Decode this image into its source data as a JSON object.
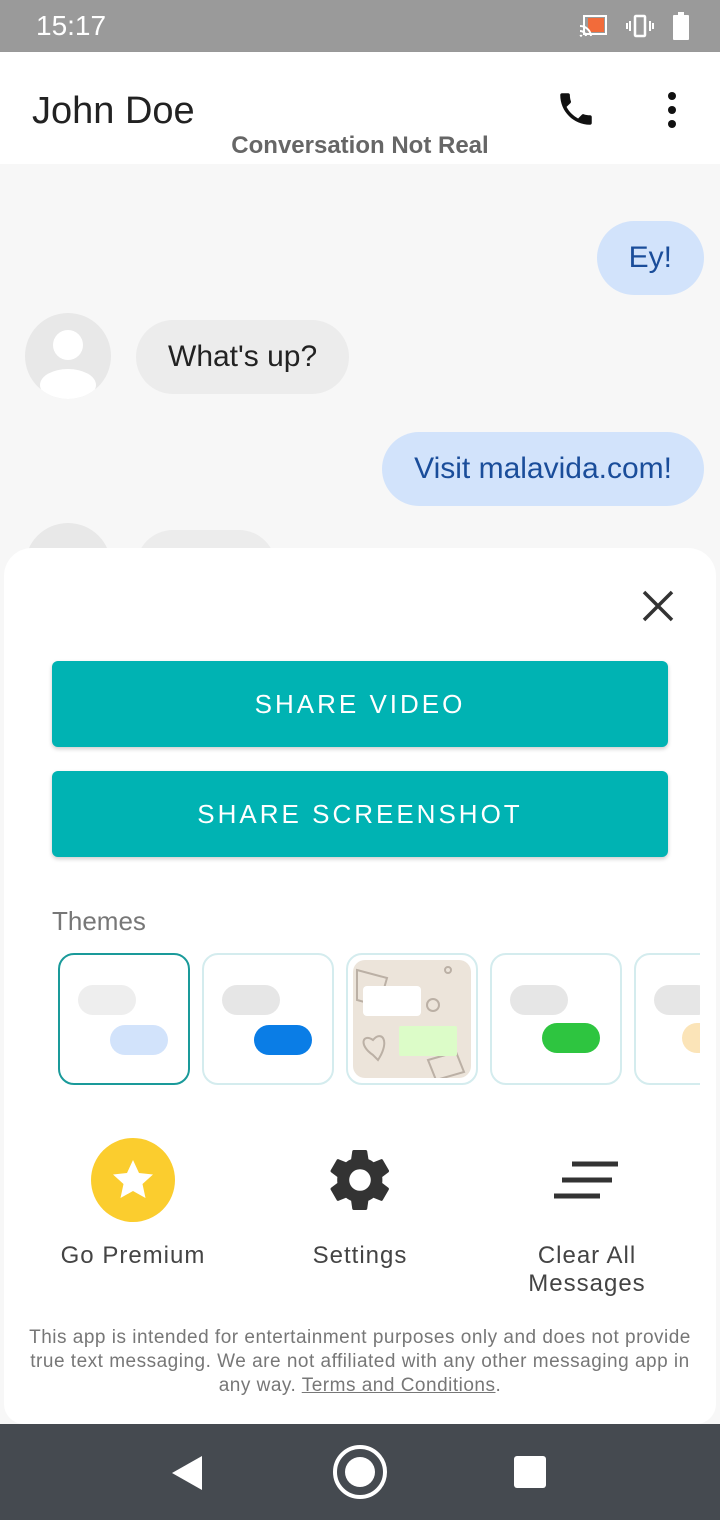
{
  "status": {
    "time": "15:17",
    "icons": [
      "cast-icon",
      "vibrate-icon",
      "battery-icon"
    ]
  },
  "header": {
    "contact_name": "John Doe",
    "subtitle": "Conversation Not Real",
    "icons": [
      "phone-icon",
      "more-vert-icon"
    ]
  },
  "messages": [
    {
      "direction": "outgoing",
      "text": "Ey!"
    },
    {
      "direction": "incoming",
      "text": "What's up?"
    },
    {
      "direction": "outgoing",
      "text": "Visit malavida.com!"
    }
  ],
  "sheet": {
    "share_video": "SHARE VIDEO",
    "share_screenshot": "SHARE SCREENSHOT",
    "themes_label": "Themes",
    "themes": [
      {
        "incoming": "#eeeeee",
        "outgoing": "#d2e3fb",
        "selected": true
      },
      {
        "incoming": "#e6e6e6",
        "outgoing": "#0a7de6",
        "selected": false
      },
      {
        "incoming": "#ffffff",
        "outgoing": "#dcfcc8",
        "background": "#ece4da",
        "selected": false
      },
      {
        "incoming": "#e6e6e6",
        "outgoing": "#2ec540",
        "selected": false
      },
      {
        "incoming": "#e6e6e6",
        "outgoing": "#fbe4b8",
        "selected": false
      }
    ],
    "actions": [
      {
        "label": "Go Premium",
        "icon": "star-icon",
        "color": "#fbcd2e"
      },
      {
        "label": "Settings",
        "icon": "gear-icon"
      },
      {
        "label": "Clear All Messages",
        "icon": "clear-lines-icon"
      }
    ],
    "disclaimer": "This app is intended for entertainment purposes only and does not provide true text messaging. We are not affiliated with any other messaging app in any way.",
    "terms_link": "Terms and Conditions",
    "accent": "#00b3b3"
  }
}
